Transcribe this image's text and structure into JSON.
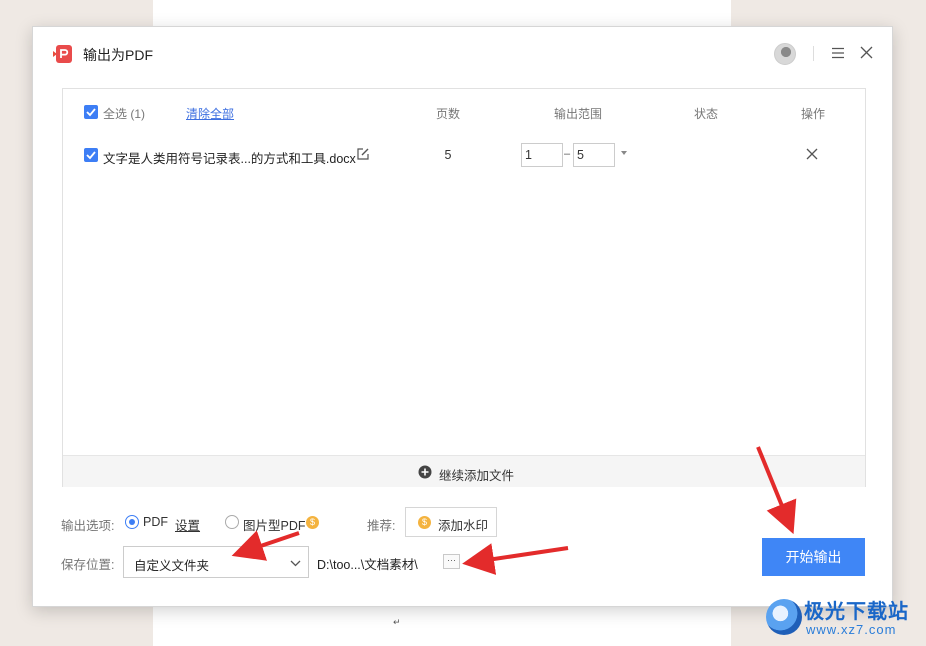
{
  "document": {
    "paragraph_mark": "↵"
  },
  "dialog": {
    "title": "输出为PDF",
    "file_list": {
      "select_all_label": "全选",
      "select_count": "(1)",
      "clear_all_label": "清除全部",
      "columns": {
        "pages": "页数",
        "output_range": "输出范围",
        "status": "状态",
        "action": "操作"
      },
      "files": [
        {
          "name": "文字是人类用符号记录表...的方式和工具.docx",
          "pages": "5",
          "range_from": "1",
          "range_to": "5",
          "status": ""
        }
      ],
      "add_more_label": "继续添加文件"
    },
    "output_options": {
      "label": "输出选项:",
      "pdf_option": "PDF",
      "settings_link": "设置",
      "image_pdf_option": "图片型PDF",
      "selected": "PDF",
      "recommend_label": "推荐:",
      "watermark_button": "添加水印"
    },
    "save_location": {
      "label": "保存位置:",
      "selected": "自定义文件夹",
      "path": "D:\\too...\\文档素材\\",
      "browse_label": "···"
    },
    "start_button": "开始输出"
  },
  "colors": {
    "accent": "#3f86f6",
    "annotation_arrow": "#e32b2b",
    "checkbox": "#3d7ef5"
  },
  "watermark": {
    "site_name": "极光下载站",
    "site_url": "www.xz7.com"
  }
}
